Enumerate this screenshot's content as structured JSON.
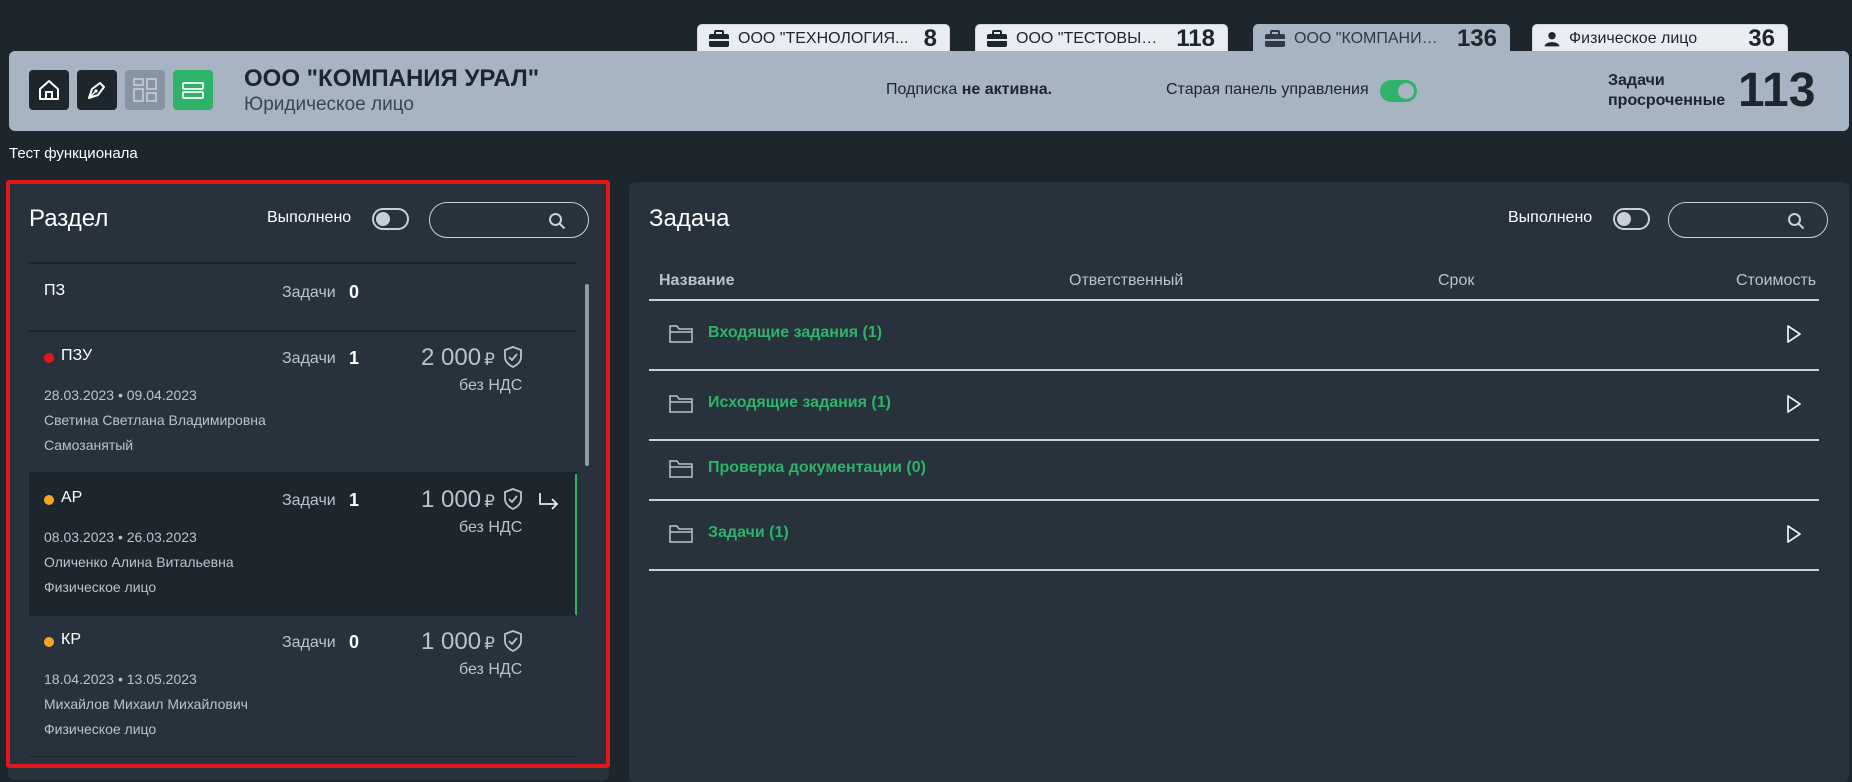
{
  "org_tabs": [
    {
      "label": "ООО \"ТЕХНОЛОГИЯ...",
      "count": "8",
      "icon": "briefcase-icon"
    },
    {
      "label": "ООО \"ТЕСТОВЫЕ Р...",
      "count": "118",
      "icon": "briefcase-icon"
    },
    {
      "label": "ООО \"КОМПАНИЯ У...",
      "count": "136",
      "icon": "briefcase-icon"
    },
    {
      "label": "Физическое лицо",
      "count": "36",
      "icon": "user-icon"
    }
  ],
  "header": {
    "company_name": "ООО \"КОМПАНИЯ УРАЛ\"",
    "company_type": "Юридическое лицо",
    "subscription_prefix": "Подписка",
    "subscription_status": "не активна.",
    "old_panel_label": "Старая панель управления",
    "overdue_label": "Задачи просроченные",
    "overdue_count": "113"
  },
  "breadcrumb": "Тест функционала",
  "section_panel": {
    "title": "Раздел",
    "done_label": "Выполнено",
    "search_placeholder": "",
    "tasks_label": "Задачи",
    "rows": [
      {
        "name": "ПЗ",
        "tasks": "0"
      },
      {
        "name": "ПЗУ",
        "tasks": "1",
        "price": "2 000",
        "currency": "₽",
        "vat": "без НДС",
        "dates": "28.03.2023  •  09.04.2023",
        "person": "Светина Светлана Владимировна",
        "person_type": "Самозанятый",
        "status_color": "#e3161b"
      },
      {
        "name": "АР",
        "tasks": "1",
        "price": "1 000",
        "currency": "₽",
        "vat": "без НДС",
        "dates": "08.03.2023  •  26.03.2023",
        "person": "Оличенко Алина Витальевна",
        "person_type": "Физическое лицо",
        "status_color": "#f5a623"
      },
      {
        "name": "КР",
        "tasks": "0",
        "price": "1 000",
        "currency": "₽",
        "vat": "без НДС",
        "dates": "18.04.2023  •  13.05.2023",
        "person": "Михайлов Михаил Михайлович",
        "person_type": "Физическое лицо",
        "status_color": "#f5a623"
      }
    ]
  },
  "task_panel": {
    "title": "Задача",
    "done_label": "Выполнено",
    "search_placeholder": "",
    "columns": [
      "Название",
      "Ответственный",
      "Срок",
      "Стоимость"
    ],
    "folders": [
      {
        "label": "Входящие задания (1)",
        "expandable": true
      },
      {
        "label": "Исходящие задания (1)",
        "expandable": true
      },
      {
        "label": "Проверка документации (0)",
        "expandable": false
      },
      {
        "label": "Задачи (1)",
        "expandable": true
      }
    ]
  },
  "colors": {
    "background": "#1d252d",
    "panel": "#28323c",
    "header": "#a7b4c1",
    "accent_green": "#2fb36a",
    "highlight_red": "#e3161b"
  }
}
